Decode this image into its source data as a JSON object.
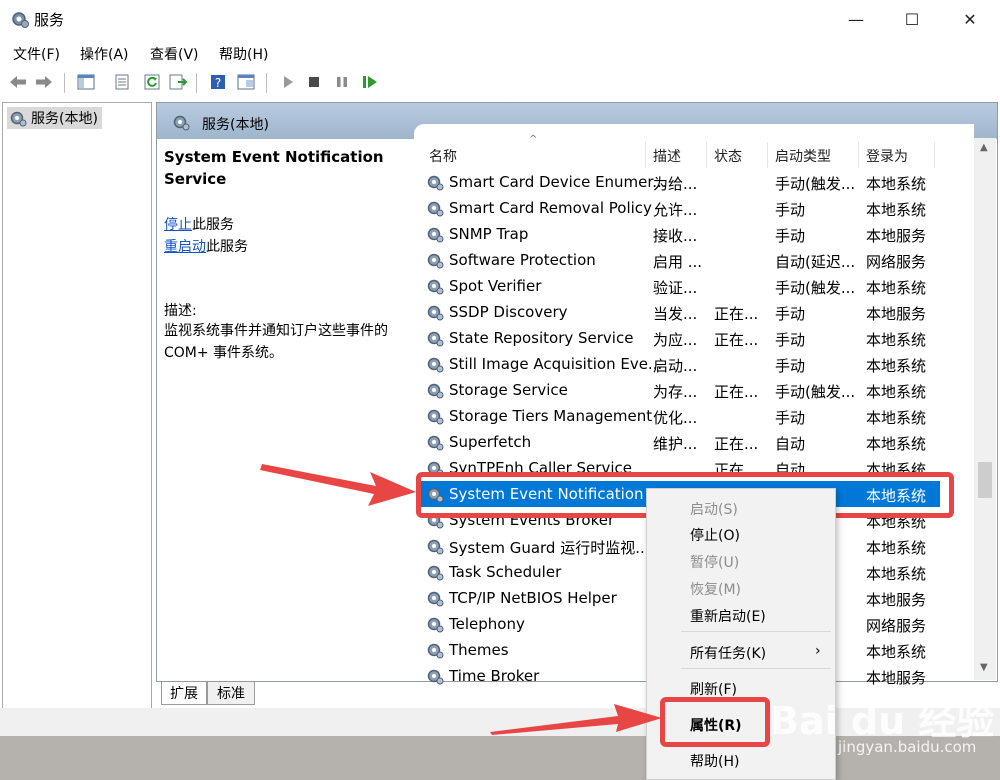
{
  "window": {
    "title": "服务",
    "controls": {
      "minimize": "—",
      "maximize": "☐",
      "close": "✕"
    }
  },
  "menu": [
    "文件(F)",
    "操作(A)",
    "查看(V)",
    "帮助(H)"
  ],
  "toolbar": {
    "buttons": [
      "back-icon",
      "forward-icon",
      "show-hide-tree-icon",
      "properties-icon",
      "refresh-icon",
      "export-list-icon",
      "help-icon",
      "console-icon",
      "start-service-icon",
      "stop-service-icon",
      "pause-service-icon",
      "restart-service-icon"
    ]
  },
  "tree": {
    "root": "服务(本地)"
  },
  "pane": {
    "title": "服务(本地)"
  },
  "detail": {
    "title": "System Event Notification Service",
    "action1_link": "停止",
    "action1_suffix": "此服务",
    "action2_link": "重启动",
    "action2_suffix": "此服务",
    "desc_label": "描述:",
    "desc_text": "监视系统事件并通知订户这些事件的 COM+ 事件系统。"
  },
  "columns": {
    "name": "名称",
    "desc": "描述",
    "status": "状态",
    "startup": "启动类型",
    "logon": "登录为"
  },
  "services": [
    {
      "name": "Smart Card Device Enumer...",
      "desc": "为给...",
      "status": "",
      "startup": "手动(触发...",
      "logon": "本地系统"
    },
    {
      "name": "Smart Card Removal Policy",
      "desc": "允许...",
      "status": "",
      "startup": "手动",
      "logon": "本地系统"
    },
    {
      "name": "SNMP Trap",
      "desc": "接收...",
      "status": "",
      "startup": "手动",
      "logon": "本地服务"
    },
    {
      "name": "Software Protection",
      "desc": "启用 ...",
      "status": "",
      "startup": "自动(延迟...",
      "logon": "网络服务"
    },
    {
      "name": "Spot Verifier",
      "desc": "验证...",
      "status": "",
      "startup": "手动(触发...",
      "logon": "本地系统"
    },
    {
      "name": "SSDP Discovery",
      "desc": "当发...",
      "status": "正在...",
      "startup": "手动",
      "logon": "本地服务"
    },
    {
      "name": "State Repository Service",
      "desc": "为应...",
      "status": "正在...",
      "startup": "手动",
      "logon": "本地系统"
    },
    {
      "name": "Still Image Acquisition Eve...",
      "desc": "启动...",
      "status": "",
      "startup": "手动",
      "logon": "本地系统"
    },
    {
      "name": "Storage Service",
      "desc": "为存...",
      "status": "正在...",
      "startup": "手动(触发...",
      "logon": "本地系统"
    },
    {
      "name": "Storage Tiers Management",
      "desc": "优化...",
      "status": "",
      "startup": "手动",
      "logon": "本地系统"
    },
    {
      "name": "Superfetch",
      "desc": "维护...",
      "status": "正在...",
      "startup": "自动",
      "logon": "本地系统"
    },
    {
      "name": "SynTPEnh Caller Service",
      "desc": "",
      "status": "正在...",
      "startup": "自动",
      "logon": "本地系统"
    },
    {
      "name": "System Event Notification ...",
      "desc": "",
      "status": "",
      "startup": "",
      "logon": "本地系统"
    },
    {
      "name": "System Events Broker",
      "desc": "",
      "status": "",
      "startup": "",
      "logon": "本地系统"
    },
    {
      "name": "System Guard 运行时监视...",
      "desc": "",
      "status": "",
      "startup": "",
      "logon": "本地系统"
    },
    {
      "name": "Task Scheduler",
      "desc": "",
      "status": "",
      "startup": "",
      "logon": "本地系统"
    },
    {
      "name": "TCP/IP NetBIOS Helper",
      "desc": "",
      "status": "",
      "startup": "",
      "logon": "本地服务"
    },
    {
      "name": "Telephony",
      "desc": "",
      "status": "",
      "startup": "",
      "logon": "网络服务"
    },
    {
      "name": "Themes",
      "desc": "",
      "status": "",
      "startup": "",
      "logon": "本地系统"
    },
    {
      "name": "Time Broker",
      "desc": "",
      "status": "",
      "startup": "",
      "logon": "本地服务"
    }
  ],
  "selected_index": 12,
  "tabs": [
    "扩展",
    "标准"
  ],
  "context_menu": [
    {
      "label": "启动(S)",
      "disabled": true
    },
    {
      "label": "停止(O)",
      "disabled": false
    },
    {
      "label": "暂停(U)",
      "disabled": true
    },
    {
      "label": "恢复(M)",
      "disabled": true
    },
    {
      "label": "重新启动(E)",
      "disabled": false
    },
    {
      "label": "所有任务(K)",
      "disabled": false,
      "submenu": "›"
    },
    {
      "label": "刷新(F)",
      "disabled": false
    },
    {
      "label": "属性(R)",
      "disabled": false,
      "bold": true
    },
    {
      "label": "帮助(H)",
      "disabled": false
    }
  ],
  "watermark": {
    "main": "Bai du 经验",
    "sub": "jingyan.baidu.com"
  },
  "colors": {
    "selection": "#0078d7",
    "annotation": "#e84545",
    "link": "#1553c4"
  }
}
